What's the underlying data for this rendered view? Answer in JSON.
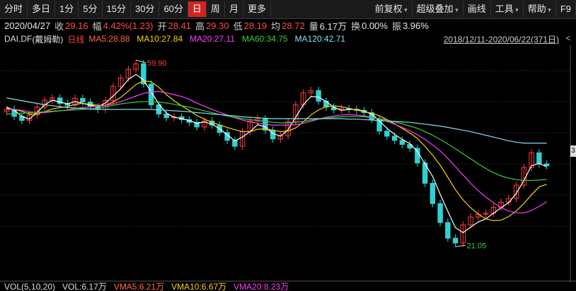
{
  "toolbar": {
    "periods": [
      "分时",
      "多日",
      "1分",
      "5分",
      "15分",
      "30分",
      "60分",
      "日",
      "周",
      "月",
      "更多"
    ],
    "active": "日",
    "fuquan": "前复权",
    "overlay": "超级叠加",
    "draw": "画线",
    "tools": "工具",
    "help": "帮助",
    "f9": "F9"
  },
  "info": {
    "date": "2020/04/27",
    "close_label": "收",
    "close": "29.16",
    "change_label": "幅",
    "change": "4.42%(1.23)",
    "open_label": "开",
    "open": "28.41",
    "high_label": "高",
    "high": "29.30",
    "low_label": "低",
    "low": "28.19",
    "avg_label": "均",
    "avg": "28.72",
    "vol_label": "量",
    "vol": "6.17万",
    "turnover_label": "换",
    "turnover": "0.00%",
    "amp_label": "振",
    "amp": "3.96%"
  },
  "ma": {
    "symbol": "DAI.DF",
    "name": "(戴姆勒)",
    "period": "日线",
    "ma5": "MA5:28.88",
    "ma10": "MA10:27.84",
    "ma20": "MA20:27.11",
    "ma60": "MA60:34.75",
    "ma120": "MA120:42.71",
    "range": "2018/12/11-2020/06/22(371日)",
    "range_btn": "<"
  },
  "annotations": {
    "high": "59.90",
    "low": "21.05",
    "right_mark": "3"
  },
  "volume": {
    "title": "VOL(5,10,20)",
    "vol": "VOL:6.17万",
    "vma5": "VMA5:6.21万",
    "vma10": "VMA10:6.67万",
    "vma20": "VMA20:8.23万"
  },
  "colors": {
    "up": "#ff3c3c",
    "down": "#2fd1d1",
    "ma5": "#ffffff",
    "ma10": "#ffd200",
    "ma20": "#ff3cff",
    "ma60": "#3ccd3c",
    "ma120": "#7fe0e8"
  },
  "chart_data": {
    "type": "candlestick",
    "series": [
      {
        "name": "MA5",
        "values": [
          50.5,
          49.8,
          48.5,
          47.9,
          49.4,
          51.0,
          52.0,
          51.6,
          51.2,
          51.7,
          51.3,
          50.9,
          50.6,
          51.4,
          52.9,
          54.5,
          56.5,
          57.6,
          56.4,
          53.8,
          51.2,
          49.2,
          48.3,
          48.0,
          47.6,
          47.0,
          47.3,
          46.8,
          45.8,
          44.5,
          43.2,
          44.0,
          45.2,
          46.7,
          46.2,
          44.8,
          44.2,
          45.6,
          48.3,
          51.0,
          52.8,
          52.7,
          51.7,
          50.5,
          49.8,
          50.0,
          50.0,
          49.6,
          49.0,
          47.5,
          45.9,
          44.6,
          43.5,
          42.6,
          40.9,
          38.2,
          35.5,
          31.6,
          27.9,
          24.4,
          23.3,
          24.5,
          25.6,
          26.3,
          27.5,
          28.7,
          29.8,
          31.8,
          34.6,
          37.8,
          38.3,
          37.6
        ]
      },
      {
        "name": "MA10",
        "values": [
          50.2,
          50.0,
          49.6,
          49.0,
          49.0,
          49.5,
          50.1,
          50.4,
          50.6,
          51.1,
          51.3,
          51.1,
          50.9,
          50.9,
          51.6,
          52.6,
          54.0,
          55.4,
          56.2,
          56.0,
          54.8,
          53.2,
          51.9,
          50.8,
          49.8,
          48.7,
          47.9,
          47.2,
          46.6,
          46.1,
          45.6,
          45.2,
          45.2,
          45.7,
          45.8,
          45.5,
          45.2,
          45.3,
          46.0,
          47.3,
          48.8,
          49.9,
          50.6,
          50.8,
          50.6,
          50.2,
          49.9,
          49.5,
          49.2,
          48.6,
          47.8,
          46.9,
          45.9,
          44.9,
          43.7,
          42.0,
          40.1,
          37.9,
          35.3,
          32.6,
          30.4,
          28.7,
          27.3,
          26.3,
          25.9,
          26.0,
          26.8,
          28.0,
          29.6,
          31.5,
          33.2,
          33.8
        ]
      },
      {
        "name": "MA20",
        "values": [
          50.0,
          50.0,
          49.8,
          49.5,
          49.3,
          49.3,
          49.5,
          49.7,
          49.9,
          50.2,
          50.4,
          50.6,
          50.7,
          50.9,
          51.2,
          51.7,
          52.3,
          52.9,
          53.5,
          53.8,
          53.9,
          53.6,
          53.2,
          52.8,
          52.2,
          51.4,
          50.7,
          50.0,
          49.4,
          48.8,
          48.2,
          47.7,
          47.3,
          47.0,
          46.8,
          46.6,
          46.6,
          46.6,
          46.7,
          47.0,
          47.4,
          47.9,
          48.3,
          48.6,
          48.8,
          48.9,
          48.8,
          48.6,
          48.3,
          47.9,
          47.4,
          46.8,
          46.1,
          45.4,
          44.5,
          43.5,
          42.3,
          41.0,
          39.4,
          37.6,
          35.8,
          34.0,
          32.4,
          31.0,
          29.8,
          28.7,
          28.0,
          27.6,
          27.6,
          28.1,
          29.0,
          30.0
        ]
      },
      {
        "name": "MA60",
        "values": [
          49.0,
          49.1,
          49.2,
          49.3,
          49.4,
          49.5,
          49.6,
          49.7,
          49.8,
          49.9,
          50.0,
          50.1,
          50.3,
          50.6,
          50.9,
          51.2,
          51.4,
          51.6,
          51.7,
          51.7,
          51.6,
          51.4,
          51.1,
          50.8,
          50.5,
          50.1,
          49.7,
          49.3,
          48.9,
          48.6,
          48.3,
          48.0,
          47.8,
          47.6,
          47.4,
          47.2,
          47.1,
          47.1,
          47.2,
          47.4,
          47.7,
          47.9,
          48.1,
          48.3,
          48.4,
          48.5,
          48.5,
          48.4,
          48.2,
          48.0,
          47.7,
          47.3,
          46.9,
          46.4,
          45.9,
          45.2,
          44.4,
          43.5,
          42.5,
          41.5,
          40.4,
          39.3,
          38.2,
          37.2,
          36.3,
          35.6,
          35.1,
          34.8,
          34.6,
          34.6,
          34.7,
          34.8
        ]
      },
      {
        "name": "MA120",
        "values": [
          52.5,
          52.2,
          51.9,
          51.6,
          51.3,
          51.0,
          50.8,
          50.6,
          50.4,
          50.3,
          50.2,
          50.1,
          50.0,
          50.0,
          50.0,
          50.0,
          50.0,
          50.0,
          50.0,
          50.0,
          49.9,
          49.8,
          49.7,
          49.6,
          49.5,
          49.3,
          49.2,
          49.0,
          48.9,
          48.7,
          48.6,
          48.4,
          48.3,
          48.2,
          48.1,
          48.0,
          48.0,
          48.0,
          48.0,
          48.0,
          48.0,
          48.0,
          48.0,
          48.0,
          48.0,
          47.9,
          47.9,
          47.8,
          47.7,
          47.6,
          47.5,
          47.4,
          47.3,
          47.2,
          47.0,
          46.8,
          46.6,
          46.4,
          46.1,
          45.8,
          45.5,
          45.2,
          44.8,
          44.4,
          44.0,
          43.6,
          43.2,
          42.9,
          42.7,
          42.7,
          42.7,
          42.7
        ]
      }
    ],
    "close": [
      50.0,
      48.5,
      47.6,
      48.8,
      50.5,
      52.0,
      52.5,
      51.3,
      50.9,
      52.4,
      51.6,
      50.6,
      50.0,
      51.9,
      55.0,
      56.8,
      58.7,
      59.9,
      55.5,
      51.0,
      49.0,
      48.2,
      48.4,
      47.8,
      47.2,
      46.2,
      47.5,
      46.6,
      45.0,
      43.3,
      42.0,
      45.2,
      47.5,
      48.0,
      45.5,
      43.6,
      44.3,
      47.3,
      51.0,
      53.6,
      54.1,
      51.8,
      50.5,
      49.9,
      50.2,
      50.0,
      49.8,
      49.3,
      47.8,
      45.3,
      44.2,
      43.3,
      42.4,
      41.6,
      38.4,
      34.0,
      29.6,
      25.5,
      22.1,
      21.05,
      25.0,
      26.7,
      27.3,
      27.5,
      28.8,
      29.9,
      30.7,
      33.6,
      37.4,
      40.6,
      38.2,
      37.8
    ],
    "ylim": [
      18,
      63
    ],
    "high_marker": 59.9,
    "low_marker": 21.05,
    "date_range": "2018/12/11-2020/06/22(371日)"
  }
}
